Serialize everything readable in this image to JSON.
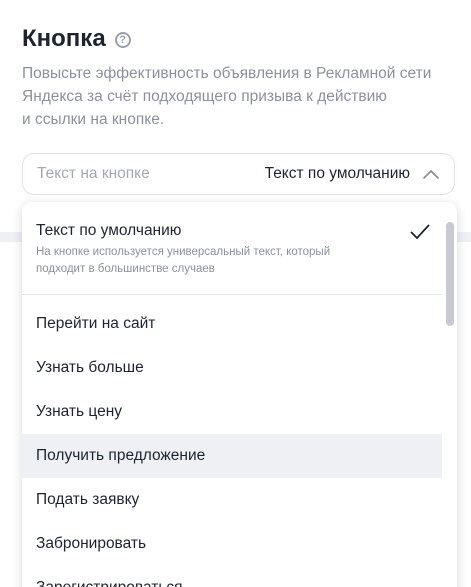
{
  "section": {
    "title": "Кнопка",
    "help_icon": "question-circle-icon",
    "description_lines": [
      "Повысьте эффективность объявления в Рекламной сети",
      "Яндекса за счёт подходящего призыва к действию",
      "и ссылки на кнопке."
    ]
  },
  "select": {
    "label": "Текст на кнопке",
    "value": "Текст по умолчанию",
    "icon": "chevron-up-icon",
    "expanded": true
  },
  "dropdown": {
    "default_option": {
      "title": "Текст по умолчанию",
      "description_lines": [
        "На кнопке используется универсальный текст, который",
        "подходит в большинстве случаев"
      ],
      "selected": true,
      "icon": "checkmark-icon"
    },
    "options": [
      {
        "label": "Перейти на сайт",
        "hovered": false
      },
      {
        "label": "Узнать больше",
        "hovered": false
      },
      {
        "label": "Узнать цену",
        "hovered": false
      },
      {
        "label": "Получить предложение",
        "hovered": true
      },
      {
        "label": "Подать заявку",
        "hovered": false
      },
      {
        "label": "Забронировать",
        "hovered": false
      },
      {
        "label": "Зарегистрироваться",
        "hovered": false
      }
    ]
  },
  "colors": {
    "text_primary": "#1d2330",
    "text_secondary": "#8a909c",
    "hover_background": "#eef0f4",
    "border": "#dfe2e8"
  }
}
